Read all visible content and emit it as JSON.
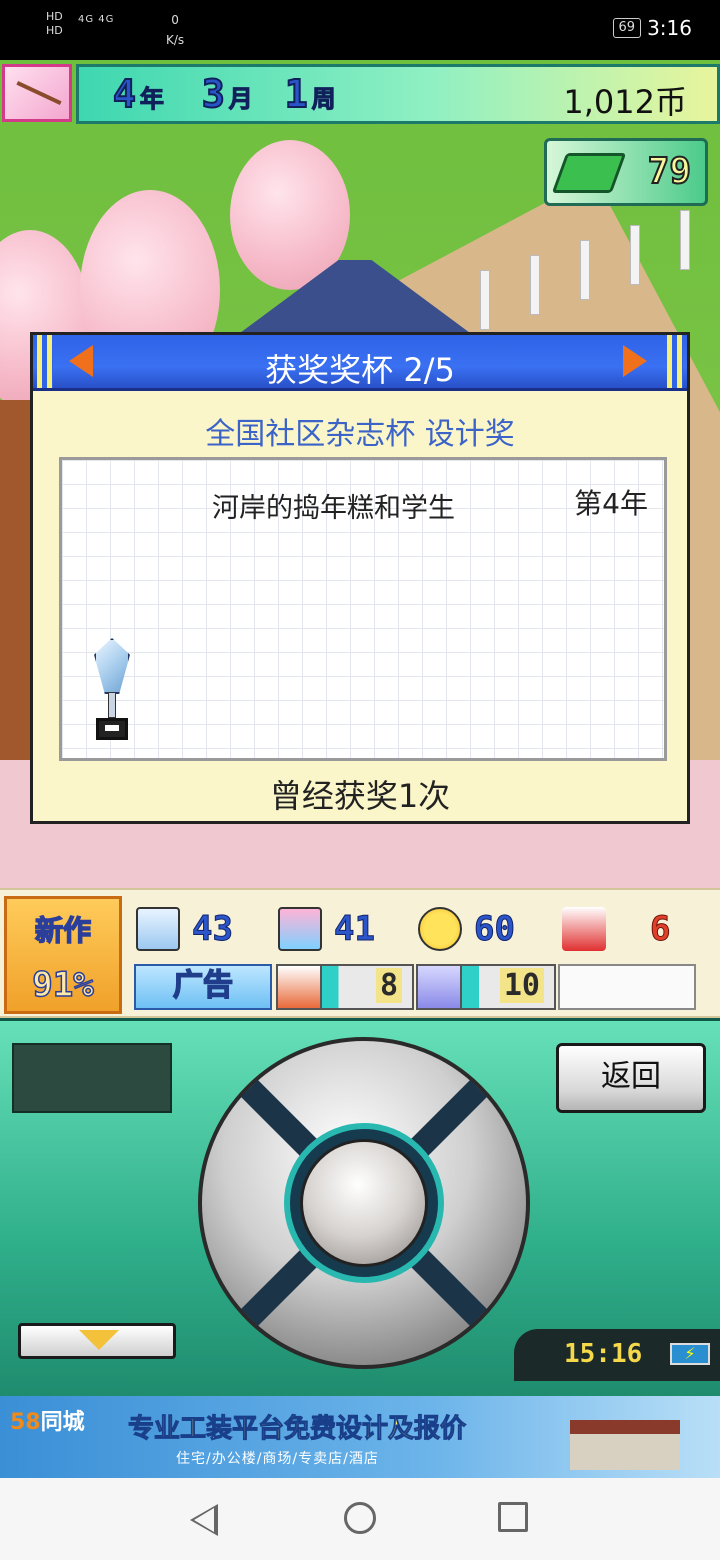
{
  "status_bar": {
    "sim_labels": [
      "HD",
      "HD"
    ],
    "network": "4G 4G",
    "speed_value": "0",
    "speed_unit": "K/s",
    "battery": "69",
    "time": "3:16"
  },
  "hud": {
    "year_num": "4",
    "year_unit": "年",
    "month_num": "3",
    "month_unit": "月",
    "week_num": "1",
    "week_unit": "周",
    "coins": "1,012币",
    "books": "79"
  },
  "dialog": {
    "title": "获奖奖杯 2/5",
    "award_name": "全国社区杂志杯 设计奖",
    "game_title": "河岸的捣年糕和学生",
    "award_year": "第4年",
    "times_won": "曾经获奖1次"
  },
  "stats": {
    "new_work_label": "新作",
    "new_work_pct": "91%",
    "stat1": "43",
    "stat2": "41",
    "stat3": "60",
    "stat4": "6",
    "ad_label": "广告",
    "gauge1": "8",
    "gauge2": "10"
  },
  "controller": {
    "back_label": "返回",
    "clock": "15:16"
  },
  "ad_banner": {
    "logo_num": "58",
    "logo_text": "同城",
    "headline": "专业工装平台免费设计及报价",
    "sub": "住宅/办公楼/商场/专卖店/酒店"
  },
  "colors": {
    "dialog_header": "#2f63e8",
    "accent_arrow": "#f0701c",
    "award_name": "#3b63c8",
    "controller": "#2fae8a"
  }
}
